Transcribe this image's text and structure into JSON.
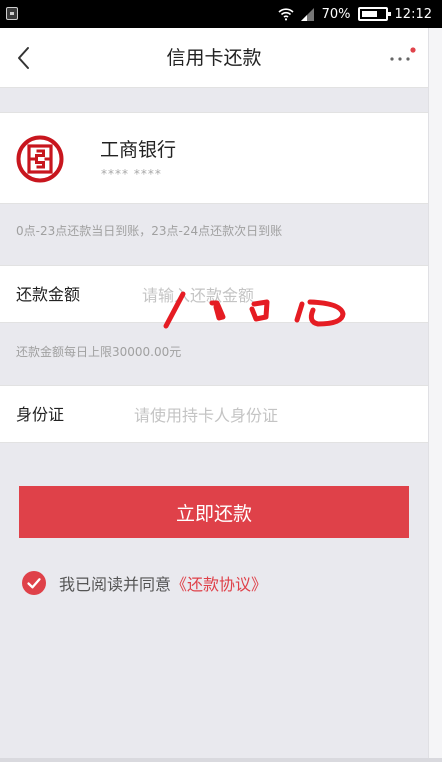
{
  "status_bar": {
    "battery": "70%",
    "battery_level": 0.7,
    "time": "12:12"
  },
  "nav": {
    "title": "信用卡还款",
    "accent_color": "#e0434b"
  },
  "bank": {
    "name": "工商银行",
    "card_number": "**** ****",
    "brand_color": "#c8161e"
  },
  "notes": {
    "time": "0点-23点还款当日到账，23点-24点还款次日到账",
    "limit": "还款金额每日上限30000.00元"
  },
  "form": {
    "amount": {
      "label": "还款金额",
      "placeholder": "请输入还款金额"
    },
    "id": {
      "label": "身份证",
      "placeholder": "请使用持卡人身份证"
    }
  },
  "actions": {
    "pay_label": "立即还款",
    "button_color": "#df4149"
  },
  "agreement": {
    "checked": true,
    "text": "我已阅读并同意",
    "link": "《还款协议》"
  },
  "icons": {
    "back": "back-chevron-icon",
    "more": "more-dots-icon",
    "wifi": "wifi-icon",
    "signal": "signal-icon",
    "battery": "battery-icon",
    "check": "check-circle-icon"
  }
}
